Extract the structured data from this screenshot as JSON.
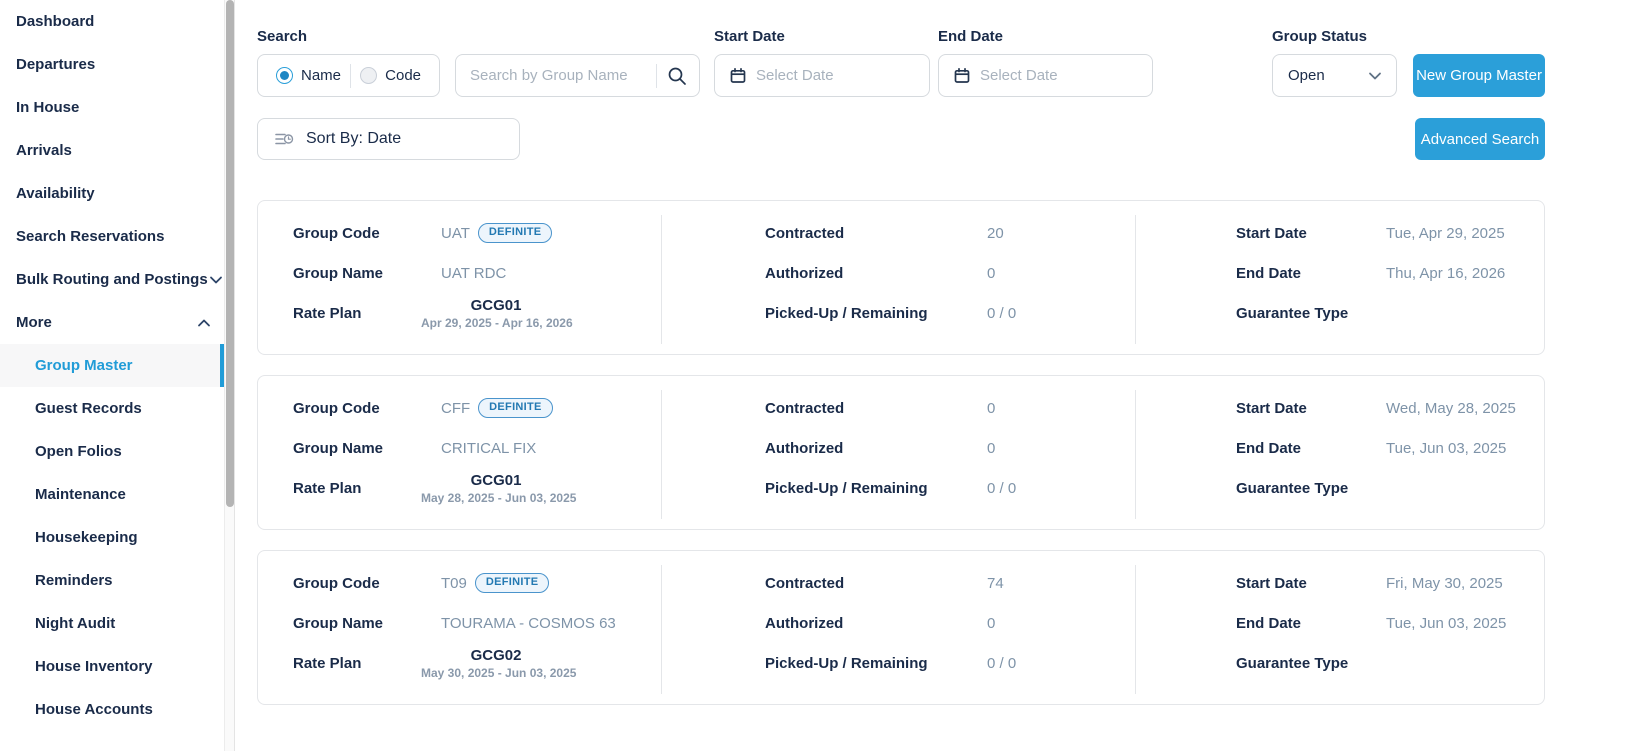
{
  "sidebar": {
    "items": [
      {
        "label": "Dashboard"
      },
      {
        "label": "Departures"
      },
      {
        "label": "In House"
      },
      {
        "label": "Arrivals"
      },
      {
        "label": "Availability"
      },
      {
        "label": "Search Reservations"
      },
      {
        "label": "Bulk Routing and Postings",
        "chevron": "down"
      },
      {
        "label": "More",
        "chevron": "up"
      },
      {
        "label": "Group Master",
        "sub": true,
        "selected": true
      },
      {
        "label": "Guest Records",
        "sub": true
      },
      {
        "label": "Open Folios",
        "sub": true
      },
      {
        "label": "Maintenance",
        "sub": true
      },
      {
        "label": "Housekeeping",
        "sub": true
      },
      {
        "label": "Reminders",
        "sub": true
      },
      {
        "label": "Night Audit",
        "sub": true
      },
      {
        "label": "House Inventory",
        "sub": true
      },
      {
        "label": "House Accounts",
        "sub": true
      }
    ]
  },
  "filters": {
    "search_label": "Search",
    "radios": [
      {
        "label": "Name",
        "selected": true
      },
      {
        "label": "Code",
        "selected": false
      }
    ],
    "search_placeholder": "Search by Group Name",
    "start_date": {
      "label": "Start Date",
      "placeholder": "Select Date"
    },
    "end_date": {
      "label": "End Date",
      "placeholder": "Select Date"
    },
    "group_status": {
      "label": "Group Status",
      "value": "Open"
    },
    "new_group_master_button": "New Group Master",
    "sort_by_button": "Sort By: Date",
    "advanced_search_button": "Advanced Search"
  },
  "card_labels": {
    "group_code": "Group Code",
    "group_name": "Group Name",
    "rate_plan": "Rate Plan",
    "contracted": "Contracted",
    "authorized": "Authorized",
    "picked_up_remaining": "Picked-Up / Remaining",
    "start_date": "Start Date",
    "end_date": "End Date",
    "guarantee_type": "Guarantee Type"
  },
  "groups": [
    {
      "code": "UAT",
      "status_badge": "DEFINITE",
      "name": "UAT RDC",
      "rate_plan_code": "GCG01",
      "rate_plan_dates": "Apr 29, 2025 - Apr 16, 2026",
      "contracted": "20",
      "authorized": "0",
      "picked_up_remaining": "0 / 0",
      "start_date": "Tue, Apr 29, 2025",
      "end_date": "Thu, Apr 16, 2026",
      "guarantee_type": ""
    },
    {
      "code": "CFF",
      "status_badge": "DEFINITE",
      "name": "CRITICAL FIX",
      "rate_plan_code": "GCG01",
      "rate_plan_dates": "May 28, 2025 - Jun 03, 2025",
      "contracted": "0",
      "authorized": "0",
      "picked_up_remaining": "0 / 0",
      "start_date": "Wed, May 28, 2025",
      "end_date": "Tue, Jun 03, 2025",
      "guarantee_type": ""
    },
    {
      "code": "T09",
      "status_badge": "DEFINITE",
      "name": "TOURAMA - COSMOS 63",
      "rate_plan_code": "GCG02",
      "rate_plan_dates": "May 30, 2025 - Jun 03, 2025",
      "contracted": "74",
      "authorized": "0",
      "picked_up_remaining": "0 / 0",
      "start_date": "Fri, May 30, 2025",
      "end_date": "Tue, Jun 03, 2025",
      "guarantee_type": ""
    }
  ],
  "colors": {
    "accent_blue": "#2b9fd9",
    "selected_nav_blue": "#219cd7",
    "navy_text": "#1a2b49",
    "value_gray_blue": "#7e93a8"
  }
}
